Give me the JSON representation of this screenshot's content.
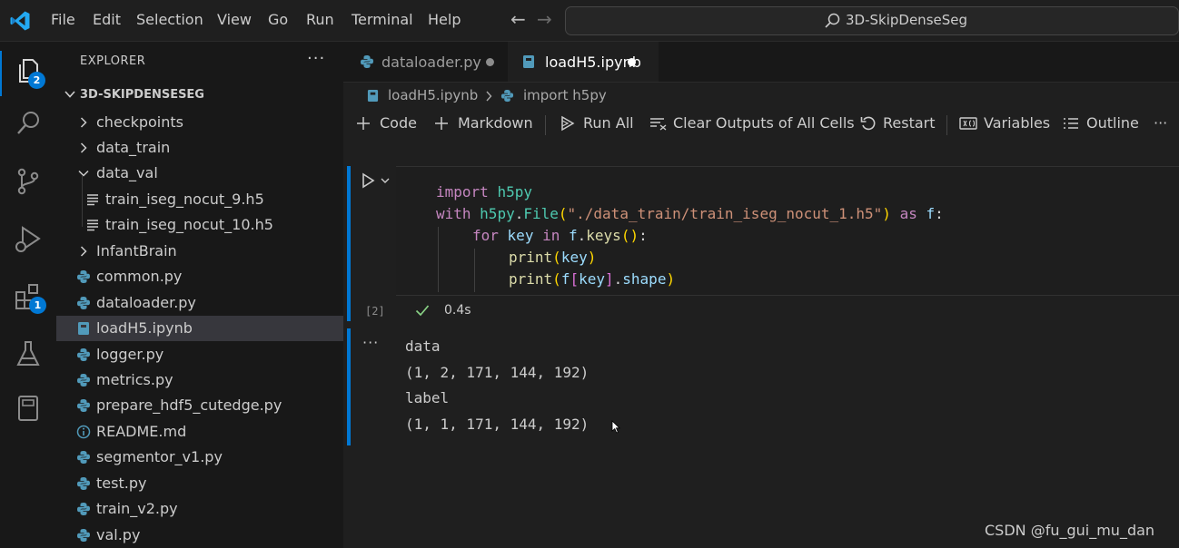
{
  "menu": [
    "File",
    "Edit",
    "Selection",
    "View",
    "Go",
    "Run",
    "Terminal",
    "Help"
  ],
  "command_center": {
    "label": "3D-SkipDenseSeg"
  },
  "activity": {
    "explorer_badge": "2",
    "extensions_badge": "1"
  },
  "sidebar": {
    "title": "EXPLORER",
    "more": "···",
    "root": "3D-SKIPDENSESEG",
    "items": [
      {
        "label": "checkpoints",
        "kind": "folder-collapsed"
      },
      {
        "label": "data_train",
        "kind": "folder-collapsed"
      },
      {
        "label": "data_val",
        "kind": "folder-expanded"
      },
      {
        "label": "train_iseg_nocut_9.h5",
        "kind": "file-lines"
      },
      {
        "label": "train_iseg_nocut_10.h5",
        "kind": "file-lines"
      },
      {
        "label": "InfantBrain",
        "kind": "folder-collapsed"
      },
      {
        "label": "common.py",
        "kind": "python"
      },
      {
        "label": "dataloader.py",
        "kind": "python"
      },
      {
        "label": "loadH5.ipynb",
        "kind": "notebook",
        "selected": true
      },
      {
        "label": "logger.py",
        "kind": "python"
      },
      {
        "label": "metrics.py",
        "kind": "python"
      },
      {
        "label": "prepare_hdf5_cutedge.py",
        "kind": "python"
      },
      {
        "label": "README.md",
        "kind": "info"
      },
      {
        "label": "segmentor_v1.py",
        "kind": "python"
      },
      {
        "label": "test.py",
        "kind": "python"
      },
      {
        "label": "train_v2.py",
        "kind": "python"
      },
      {
        "label": "val.py",
        "kind": "python"
      }
    ]
  },
  "tabs": [
    {
      "label": "dataloader.py",
      "icon": "python-icon",
      "active": false
    },
    {
      "label": "loadH5.ipynb",
      "icon": "notebook-icon",
      "active": true
    }
  ],
  "breadcrumb": {
    "file": "loadH5.ipynb",
    "symbol": "import h5py"
  },
  "toolbar": {
    "code": "Code",
    "markdown": "Markdown",
    "run_all": "Run All",
    "clear_outputs": "Clear Outputs of All Cells",
    "restart": "Restart",
    "variables": "Variables",
    "outline": "Outline",
    "more": "···"
  },
  "cell": {
    "code": {
      "l1_kw": "import",
      "l1_mod": "h5py",
      "l2_kw": "with",
      "l2_mod": "h5py",
      "l2_dot": ".",
      "l2_fn": "File",
      "l2_open": "(",
      "l2_str": "\"./data_train/train_iseg_nocut_1.h5\"",
      "l2_close": ")",
      "l2_as": "as",
      "l2_var": "f",
      "l2_colon": ":",
      "l3_kw": "for",
      "l3_var": "key",
      "l3_in": "in",
      "l3_f": "f",
      "l3_dot": ".",
      "l3_fn": "keys",
      "l3_paren": "()",
      "l3_colon": ":",
      "l4_fn": "print",
      "l4_open": "(",
      "l4_var": "key",
      "l4_close": ")",
      "l5_fn": "print",
      "l5_open": "(",
      "l5_f": "f",
      "l5_lb": "[",
      "l5_key": "key",
      "l5_rb": "]",
      "l5_dot": ".",
      "l5_shape": "shape",
      "l5_close": ")"
    },
    "exec_count": "[2]",
    "exec_time": "0.4s",
    "output_more": "···",
    "outputs": [
      "data",
      "(1, 2, 171, 144, 192)",
      "label",
      "(1, 1, 171, 144, 192)"
    ]
  },
  "watermark": "CSDN @fu_gui_mu_dan"
}
